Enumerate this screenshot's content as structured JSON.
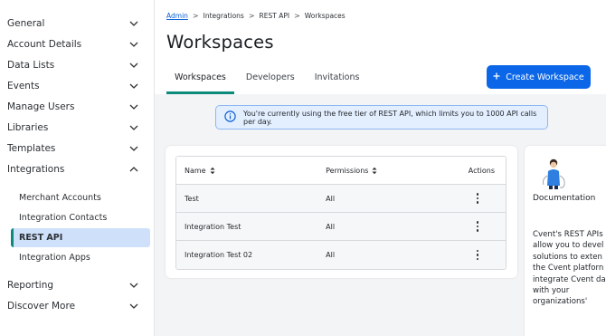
{
  "sidebar": {
    "items": [
      {
        "label": "General",
        "expanded": false
      },
      {
        "label": "Account Details",
        "expanded": false
      },
      {
        "label": "Data Lists",
        "expanded": false
      },
      {
        "label": "Events",
        "expanded": false
      },
      {
        "label": "Manage Users",
        "expanded": false
      },
      {
        "label": "Libraries",
        "expanded": false
      },
      {
        "label": "Templates",
        "expanded": false
      },
      {
        "label": "Integrations",
        "expanded": true
      },
      {
        "label": "Reporting",
        "expanded": false
      },
      {
        "label": "Discover More",
        "expanded": false
      }
    ],
    "sub_items": [
      {
        "label": "Merchant Accounts",
        "active": false
      },
      {
        "label": "Integration Contacts",
        "active": false
      },
      {
        "label": "REST API",
        "active": true
      },
      {
        "label": "Integration Apps",
        "active": false
      }
    ]
  },
  "breadcrumb": [
    "Admin",
    "Integrations",
    "REST API",
    "Workspaces"
  ],
  "page": {
    "title": "Workspaces"
  },
  "tabs": [
    {
      "label": "Workspaces",
      "active": true
    },
    {
      "label": "Developers",
      "active": false
    },
    {
      "label": "Invitations",
      "active": false
    }
  ],
  "create_button": {
    "icon": "plus-icon",
    "label": "Create Workspace"
  },
  "banner": {
    "icon": "info-icon",
    "text": "You're currently using the free tier of REST API, which limits you to 1000 API calls per day."
  },
  "table": {
    "headers": {
      "name": "Name",
      "permissions": "Permissions",
      "actions": "Actions"
    },
    "rows": [
      {
        "name": "Test",
        "permissions": "All"
      },
      {
        "name": "Integration Test",
        "permissions": "All"
      },
      {
        "name": "Integration Test 02",
        "permissions": "All"
      }
    ]
  },
  "documentation": {
    "title": "Documentation",
    "lines": [
      "Cvent's REST APIs",
      "allow you to devel",
      "solutions to exten",
      "the Cvent platforn",
      "integrate Cvent da",
      "with your",
      "organizations'"
    ]
  },
  "colors": {
    "accent": "#0c8a7c",
    "primary": "#0b67e8",
    "link": "#0b5fd6",
    "banner_bg": "#e3efff",
    "active_nav_bg": "#cfe0fb"
  }
}
